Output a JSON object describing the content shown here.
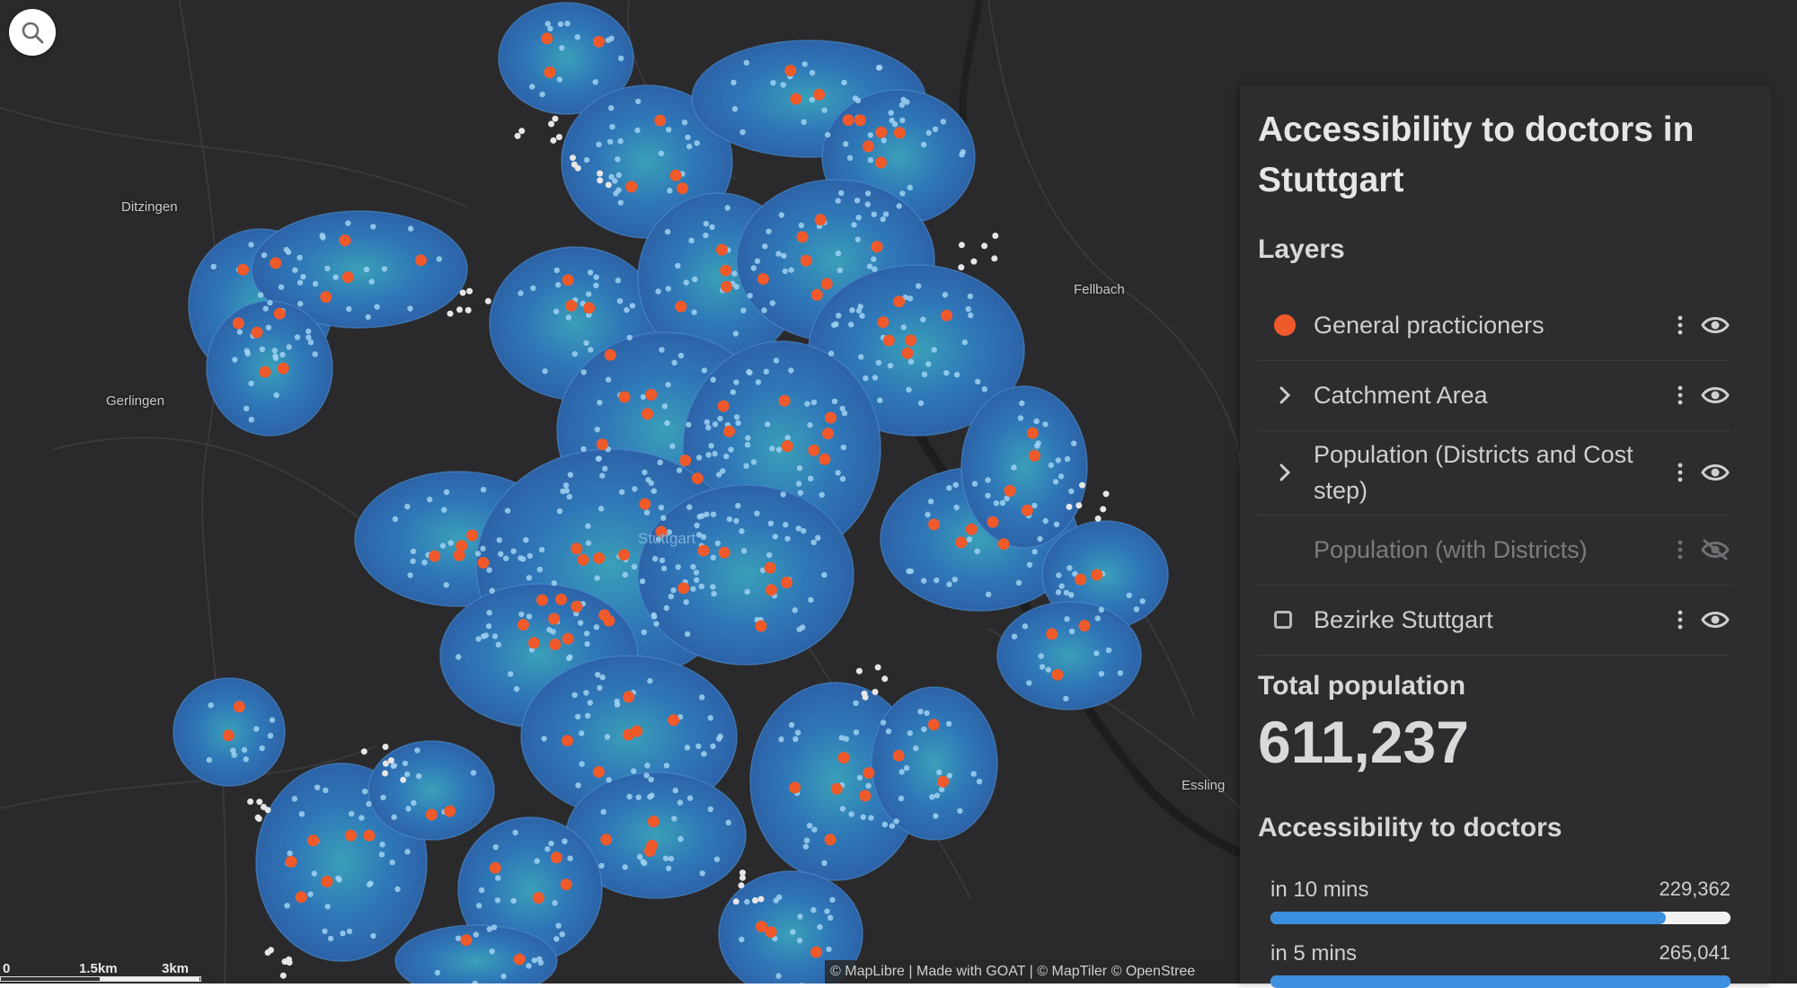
{
  "map": {
    "places": {
      "ditzingen": "Ditzingen",
      "gerlingen": "Gerlingen",
      "fellbach": "Fellbach",
      "esslingen": "Essling",
      "stuttgart": "Stuttgart"
    },
    "scale": {
      "zero": "0",
      "mid": "1.5km",
      "end": "3km"
    },
    "attribution": "© MapLibre | Made with GOAT | © MapTiler © OpenStree",
    "colors": {
      "catchment": "#2f6fb0",
      "doctor": "#f05a2b",
      "population": "#9fd2f2",
      "background": "#2a2a2c"
    }
  },
  "panel": {
    "title": "Accessibility to doctors in Stuttgart",
    "layers_heading": "Layers",
    "layers": [
      {
        "name": "General practicioners",
        "lead": "dot",
        "visible": true
      },
      {
        "name": "Catchment Area",
        "lead": "chevron",
        "visible": true
      },
      {
        "name": "Population (Districts and Cost step)",
        "lead": "chevron",
        "visible": true
      },
      {
        "name": "Population (with Districts)",
        "lead": "none",
        "visible": false
      },
      {
        "name": "Bezirke Stuttgart",
        "lead": "checkbox",
        "visible": true
      }
    ],
    "total_heading": "Total population",
    "total_value": "611,237",
    "accessibility_heading": "Accessibility to doctors",
    "accessibility": [
      {
        "label": "in 10 mins",
        "value": "229,362",
        "fraction": 0.86
      },
      {
        "label": "in 5 mins",
        "value": "265,041",
        "fraction": 1.0
      }
    ]
  }
}
